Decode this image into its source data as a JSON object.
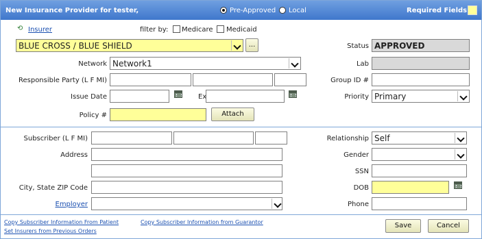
{
  "header": {
    "title": "New Insurance Provider for tester,",
    "mode_options": [
      "Pre-Approved",
      "Local"
    ],
    "mode_selected": "Pre-Approved",
    "required_label": "Required Fields"
  },
  "insurer": {
    "link_label": "Insurer",
    "filter_label": "filter by:",
    "filters": [
      "Medicare",
      "Medicaid"
    ],
    "value": "BLUE CROSS / BLUE SHIELD",
    "browse_label": "..."
  },
  "status": {
    "label": "Status",
    "value": "APPROVED"
  },
  "lab": {
    "label": "Lab",
    "value": ""
  },
  "network": {
    "label": "Network",
    "value": "Network1"
  },
  "responsible_party": {
    "label": "Responsible Party (L F MI)"
  },
  "group_id": {
    "label": "Group ID #",
    "value": ""
  },
  "issue_date": {
    "label": "Issue Date"
  },
  "expires": {
    "label": "Expires"
  },
  "priority": {
    "label": "Priority",
    "value": "Primary"
  },
  "policy": {
    "label": "Policy #",
    "attach_label": "Attach"
  },
  "subscriber": {
    "name_label": "Subscriber (L F MI)",
    "address_label": "Address",
    "city_label": "City, State ZIP Code",
    "employer_label": "Employer"
  },
  "relationship": {
    "label": "Relationship",
    "value": "Self"
  },
  "gender": {
    "label": "Gender",
    "value": ""
  },
  "ssn": {
    "label": "SSN"
  },
  "dob": {
    "label": "DOB"
  },
  "phone": {
    "label": "Phone"
  },
  "footer": {
    "links": [
      "Copy Subscriber Information From Patient",
      "Copy Subscriber Information from Guarantor",
      "Set Insurers from Previous Orders"
    ],
    "save_label": "Save",
    "cancel_label": "Cancel"
  },
  "colors": {
    "title_bar": "#4a7fd1",
    "required_yellow": "#ffff99",
    "link_blue": "#1a4fb0"
  }
}
